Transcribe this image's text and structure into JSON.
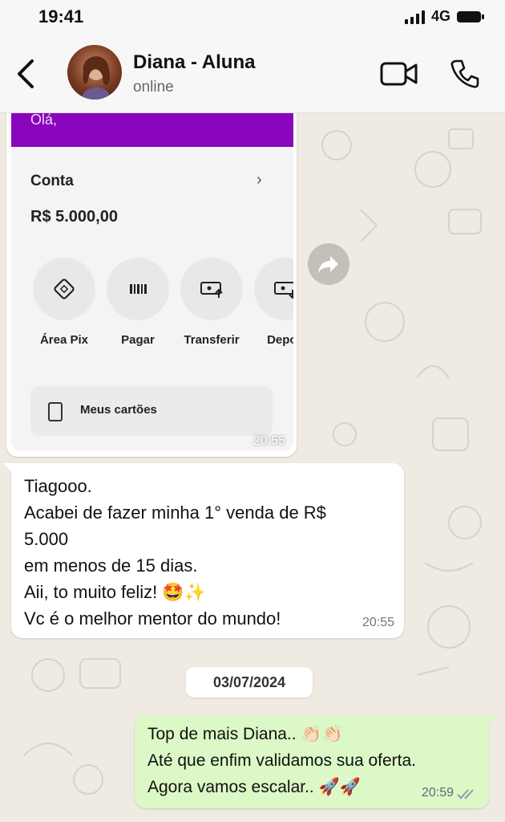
{
  "status_bar": {
    "time": "19:41",
    "network": "4G"
  },
  "header": {
    "contact_name": "Diana - Aluna",
    "contact_status": "online"
  },
  "image_message": {
    "greeting": "Olá,",
    "account_label": "Conta",
    "balance": "R$ 5.000,00",
    "actions": [
      "Área Pix",
      "Pagar",
      "Transferir",
      "Depos"
    ],
    "cards_label": "Meus cartões",
    "time": "20:55"
  },
  "received_message": {
    "lines": [
      "Tiagooo.",
      "Acabei de fazer minha 1° venda de R$",
      "5.000",
      "em menos de 15 dias.",
      "Aii, to muito feliz! 🤩✨",
      "Vc é o melhor mentor do mundo!"
    ],
    "time": "20:55"
  },
  "date_separator": "03/07/2024",
  "sent_message": {
    "lines": [
      "Top de mais Diana.. 👏🏻👏🏻",
      "Até que enfim validamos sua oferta.",
      "Agora vamos escalar.. 🚀🚀"
    ],
    "time": "20:59",
    "read_status": "read"
  },
  "colors": {
    "nubank_purple": "#8a05be",
    "chat_bg": "#efeae2",
    "sent_bubble": "#dcf8c6",
    "received_bubble": "#ffffff",
    "read_ticks": "#8e9aa6"
  },
  "icons": {
    "back": "chevron-left-icon",
    "video": "video-camera-icon",
    "call": "phone-icon",
    "forward": "forward-arrow-icon"
  }
}
